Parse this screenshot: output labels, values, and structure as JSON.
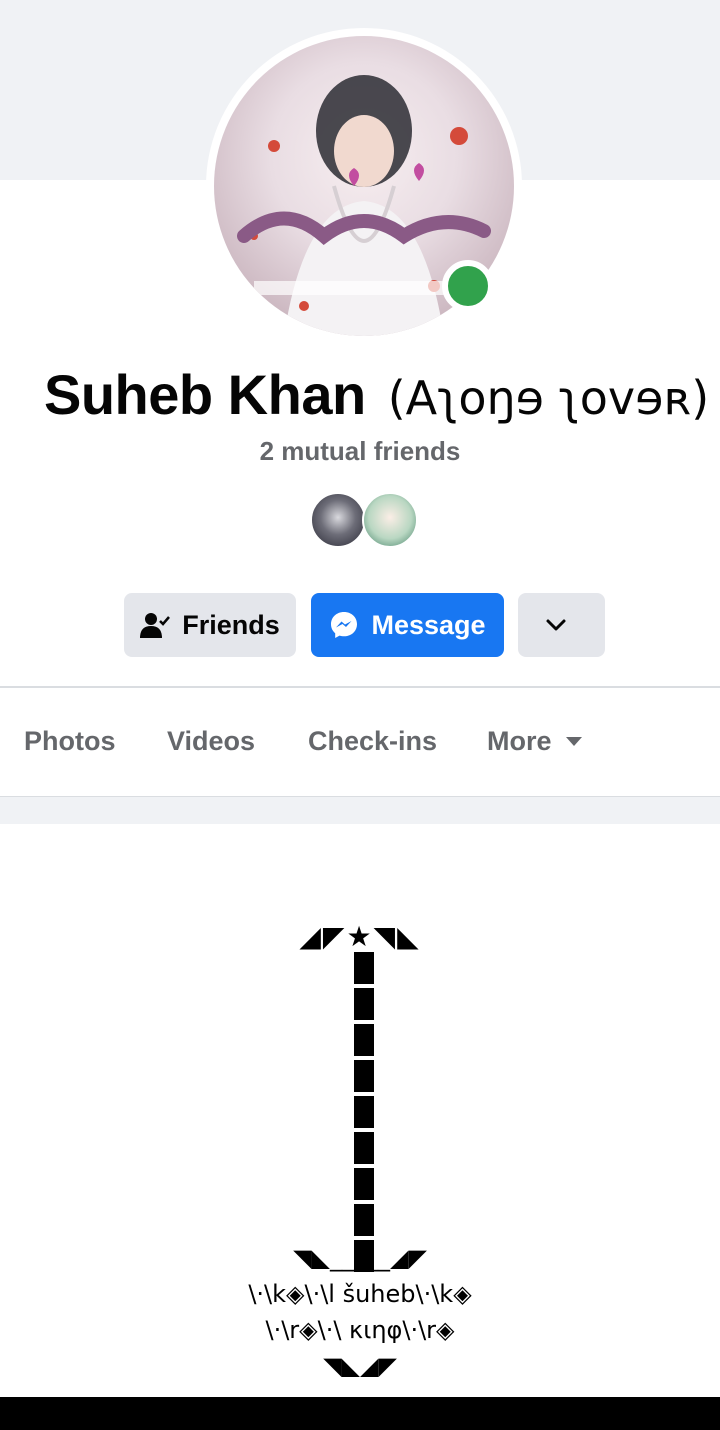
{
  "profile": {
    "name": "Suheb Khan",
    "nickname": "(Aʅoŋɘ ʅovɘʀ)",
    "mutual_friends": "2 mutual friends",
    "status_color": "#31a24c"
  },
  "actions": {
    "friends_label": "Friends",
    "message_label": "Message",
    "more_icon": "chevron-down-icon"
  },
  "tabs": [
    {
      "label": "Photos"
    },
    {
      "label": "Videos"
    },
    {
      "label": "Check-ins"
    },
    {
      "label": "More"
    }
  ],
  "post_art": {
    "top": "◢◤★◥◣",
    "bottom_wings": "◥◣_____◢◤",
    "line1": "\\·\\k◈\\·\\l šuheb\\·\\k◈",
    "line2": "\\·\\r◈\\·\\ κιηφ\\·\\r◈",
    "end": "◥◣◢◤"
  },
  "colors": {
    "accent": "#1877f2",
    "secondary_button": "#e4e6eb",
    "muted_text": "#65676b"
  }
}
